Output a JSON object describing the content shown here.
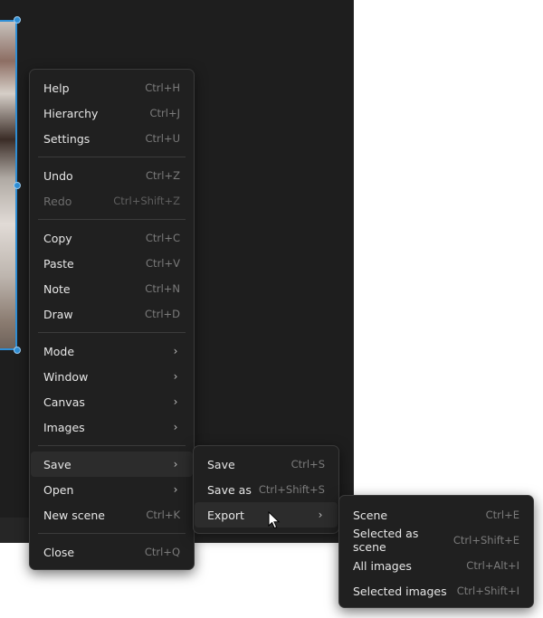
{
  "colors": {
    "canvas_bg": "#1e1e1e",
    "menu_bg": "#202020",
    "selection_accent": "#2f8fd6",
    "text": "#e6e6e6",
    "shortcut": "#7b7b7b"
  },
  "main_menu": {
    "groups": [
      [
        {
          "label": "Help",
          "shortcut": "Ctrl+H"
        },
        {
          "label": "Hierarchy",
          "shortcut": "Ctrl+J"
        },
        {
          "label": "Settings",
          "shortcut": "Ctrl+U"
        }
      ],
      [
        {
          "label": "Undo",
          "shortcut": "Ctrl+Z"
        },
        {
          "label": "Redo",
          "shortcut": "Ctrl+Shift+Z",
          "disabled": true
        }
      ],
      [
        {
          "label": "Copy",
          "shortcut": "Ctrl+C"
        },
        {
          "label": "Paste",
          "shortcut": "Ctrl+V"
        },
        {
          "label": "Note",
          "shortcut": "Ctrl+N"
        },
        {
          "label": "Draw",
          "shortcut": "Ctrl+D"
        }
      ],
      [
        {
          "label": "Mode",
          "submenu": true
        },
        {
          "label": "Window",
          "submenu": true
        },
        {
          "label": "Canvas",
          "submenu": true
        },
        {
          "label": "Images",
          "submenu": true
        }
      ],
      [
        {
          "label": "Save",
          "submenu": true,
          "active": true
        },
        {
          "label": "Open",
          "submenu": true
        },
        {
          "label": "New scene",
          "shortcut": "Ctrl+K"
        }
      ],
      [
        {
          "label": "Close",
          "shortcut": "Ctrl+Q"
        }
      ]
    ]
  },
  "save_menu": {
    "items": [
      {
        "label": "Save",
        "shortcut": "Ctrl+S"
      },
      {
        "label": "Save as",
        "shortcut": "Ctrl+Shift+S"
      },
      {
        "label": "Export",
        "submenu": true,
        "active": true
      }
    ]
  },
  "export_menu": {
    "items": [
      {
        "label": "Scene",
        "shortcut": "Ctrl+E"
      },
      {
        "label": "Selected as scene",
        "shortcut": "Ctrl+Shift+E"
      },
      {
        "label": "All images",
        "shortcut": "Ctrl+Alt+I"
      },
      {
        "label": "Selected images",
        "shortcut": "Ctrl+Shift+I"
      }
    ]
  },
  "icons": {
    "submenu_arrow": "chevron-right-icon",
    "pointer": "mouse-pointer-icon"
  }
}
